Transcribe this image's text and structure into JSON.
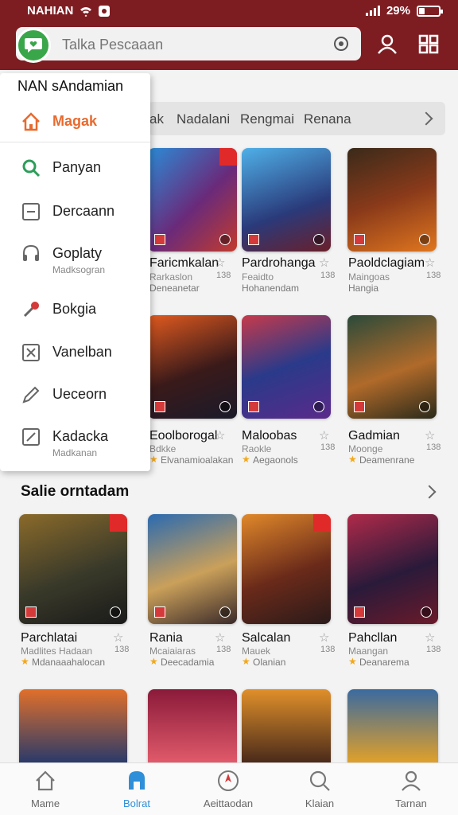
{
  "status": {
    "left_text": "NAHIAN",
    "battery": "29%",
    "battery_level": 0.29
  },
  "search": {
    "placeholder": "Talka Pescaaan"
  },
  "tabs": [
    "ak",
    "Nadalani",
    "Rengmai",
    "Renana"
  ],
  "drawer": {
    "header": "NAN sAndamian",
    "items": [
      {
        "label": "Magak",
        "sub": "",
        "icon": "home-icon",
        "active": true
      },
      {
        "label": "Panyan",
        "sub": "",
        "icon": "search-icon",
        "active": false
      },
      {
        "label": "Dercaann",
        "sub": "",
        "icon": "window-icon",
        "active": false
      },
      {
        "label": "Goplaty",
        "sub": "Madksogran",
        "icon": "headset-icon",
        "active": false
      },
      {
        "label": "Bokgia",
        "sub": "",
        "icon": "pin-icon",
        "active": false
      },
      {
        "label": "Vanelban",
        "sub": "",
        "icon": "settings-box-icon",
        "active": false
      },
      {
        "label": "Ueceorn",
        "sub": "",
        "icon": "pencil-icon",
        "active": false
      },
      {
        "label": "Kadacka",
        "sub": "Madkanan",
        "icon": "edit-box-icon",
        "active": false
      }
    ]
  },
  "rows": [
    {
      "games": [
        {
          "title": "Faricmkalan",
          "sub": "Rarkaslon",
          "meta": "Deneanetar",
          "num": "138",
          "rated": false
        },
        {
          "title": "Pardrohanga",
          "sub": "Feaidto",
          "meta": "Hohanendam",
          "num": "138",
          "rated": false
        },
        {
          "title": "Paoldclagiam",
          "sub": "Maingoas",
          "meta": "Hangia",
          "num": "138",
          "rated": false
        }
      ]
    },
    {
      "games": [
        {
          "title": "Eoolborogal",
          "sub": "Bdkke",
          "meta": "Elvanamioalakan",
          "num": "",
          "rated": true
        },
        {
          "title": "Maloobas",
          "sub": "Raokle",
          "meta": "Aegaonols",
          "num": "138",
          "rated": true
        },
        {
          "title": "Gadmian",
          "sub": "Moonge",
          "meta": "Deamenrane",
          "num": "138",
          "rated": true
        }
      ]
    }
  ],
  "section": {
    "title": "Salie orntadam",
    "games": [
      {
        "title": "Parchlatai",
        "sub": "Madlites Hadaan",
        "meta": "Mdanaaahalocan",
        "num": "138",
        "rated": true
      },
      {
        "title": "Rania",
        "sub": "Mcaiaiaras",
        "meta": "Deecadamia",
        "num": "138",
        "rated": true
      },
      {
        "title": "Salcalan",
        "sub": "Mauek",
        "meta": "Olanian",
        "num": "138",
        "rated": true
      },
      {
        "title": "Pahcllan",
        "sub": "Maangan",
        "meta": "Deanarema",
        "num": "138",
        "rated": true
      }
    ]
  },
  "bottom_nav": [
    "Mame",
    "Bolrat",
    "Aeittaodan",
    "Klaian",
    "Tarnan"
  ],
  "colors": {
    "header": "#7d1d22",
    "active_tab": "#2f8fd8",
    "drawer_active": "#e86a2e"
  }
}
